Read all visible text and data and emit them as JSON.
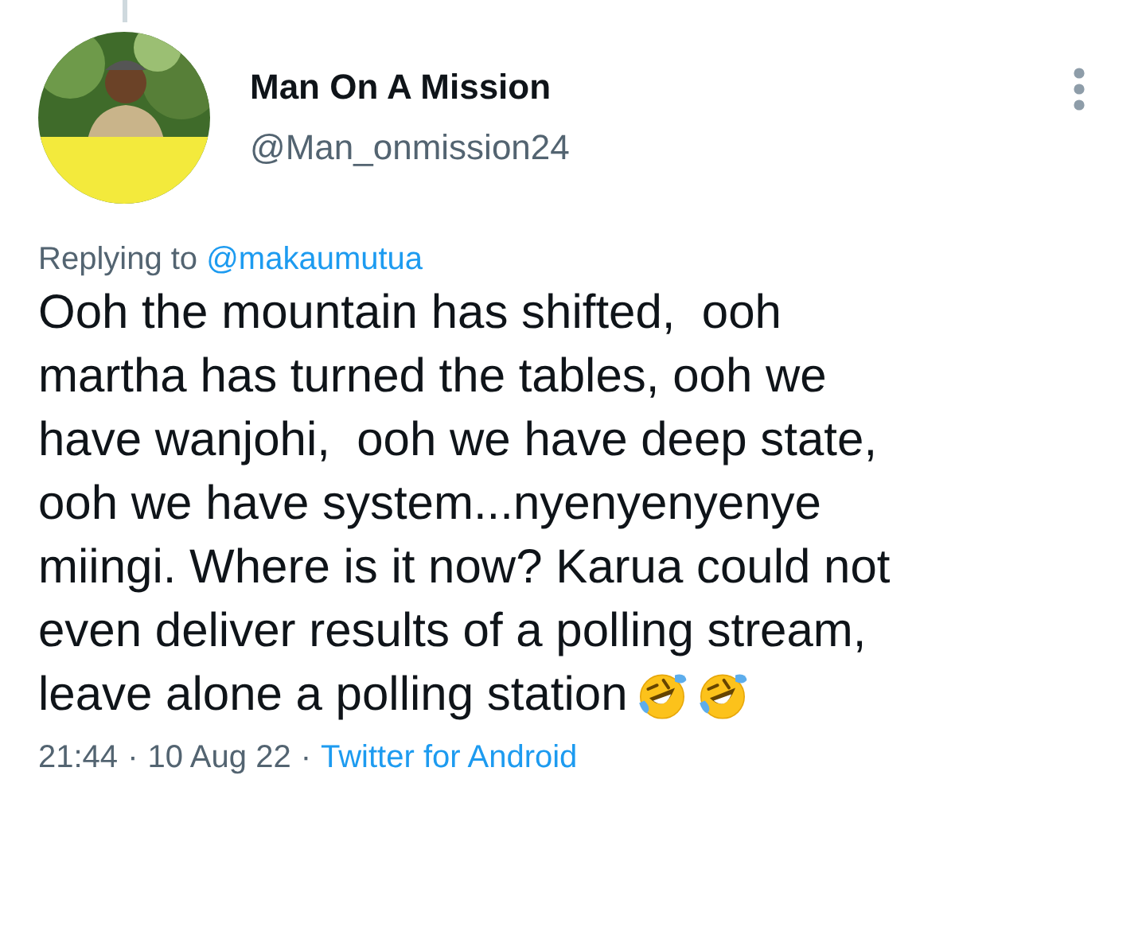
{
  "tweet": {
    "author": {
      "name": "Man On A Mission",
      "handle": "@Man_onmission24"
    },
    "reply_to": {
      "label": "Replying to ",
      "handle": "@makaumutua"
    },
    "text_lines": [
      "Ooh the mountain has shifted,  ooh",
      "martha has turned the tables, ooh we",
      "have wanjohi,  ooh we have deep state,",
      "ooh we have system...nyenyenyenye",
      "miingi. Where is it now? Karua could not",
      "even deliver results of a polling stream,",
      "leave alone a polling station"
    ],
    "emojis": [
      {
        "kind": "rolling-laughing"
      },
      {
        "kind": "rolling-laughing"
      }
    ],
    "meta": {
      "time": "21:44",
      "separator": "·",
      "date": "10 Aug 22",
      "separator_2": "·",
      "source": "Twitter for Android"
    }
  }
}
